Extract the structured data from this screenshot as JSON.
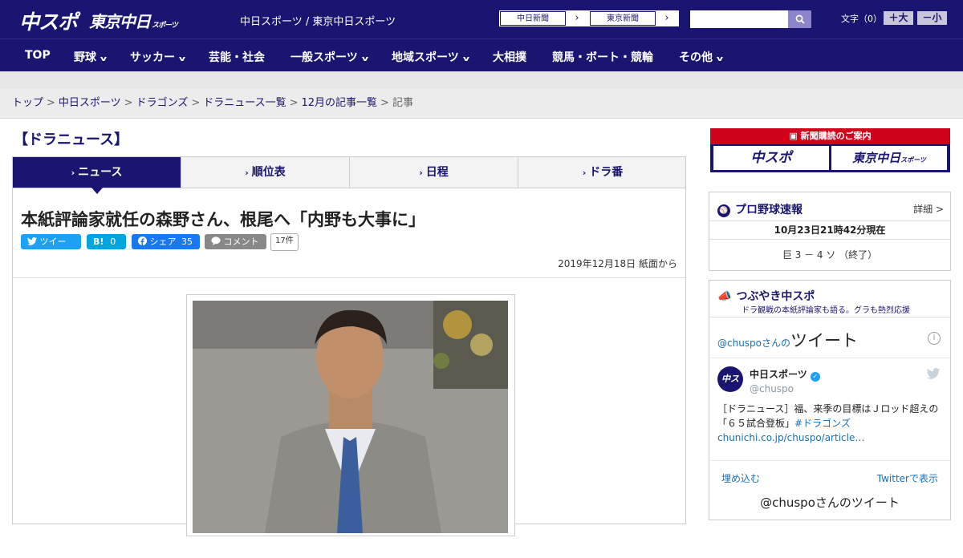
{
  "header": {
    "logo_main": "中スポ",
    "logo_tokyo": "東京中日",
    "logo_tokyo_sub": "スポーツ",
    "tagline": "中日スポーツ / 東京中日スポーツ",
    "paper_links": [
      {
        "label": "中日新聞"
      },
      {
        "label": "東京新聞"
      }
    ],
    "search": {
      "placeholder": "",
      "value": ""
    },
    "font_size_label": "文字（0）",
    "font_plus": "＋大",
    "font_minus": "－小"
  },
  "nav": {
    "items": [
      {
        "label": "TOP",
        "has_menu": false
      },
      {
        "label": "野球",
        "has_menu": true
      },
      {
        "label": "サッカー",
        "has_menu": true
      },
      {
        "label": "芸能・社会",
        "has_menu": false
      },
      {
        "label": "一般スポーツ",
        "has_menu": true
      },
      {
        "label": "地域スポーツ",
        "has_menu": true
      },
      {
        "label": "大相撲",
        "has_menu": false
      },
      {
        "label": "競馬・ボート・競輪",
        "has_menu": false
      },
      {
        "label": "その他",
        "has_menu": true
      }
    ]
  },
  "breadcrumb": {
    "items": [
      "トップ",
      "中日スポーツ",
      "ドラゴンズ",
      "ドラニュース一覧",
      "12月の記事一覧"
    ],
    "current": "記事",
    "separator": ">"
  },
  "section_title": "【ドラニュース】",
  "tabs": [
    {
      "label": "ニュース",
      "active": true
    },
    {
      "label": "順位表",
      "active": false
    },
    {
      "label": "日程",
      "active": false
    },
    {
      "label": "ドラ番",
      "active": false
    }
  ],
  "article": {
    "headline": "本紙評論家就任の森野さん、根尾へ「内野も大事に」",
    "social": {
      "tweet_label": "ツイート",
      "hatena_label": "B!",
      "hatena_count": "0",
      "share_label": "シェア",
      "share_count": "35",
      "comment_label": "コメント",
      "comment_count": "17件"
    },
    "date": "2019年12月18日 紙面から"
  },
  "sidebar": {
    "ad": {
      "top_label": "新聞購読のご案内",
      "left_logo": "中スポ",
      "right_logo": "東京中日",
      "right_logo_sub": "スポーツ"
    },
    "baseball": {
      "title": "プロ野球速報",
      "detail_link": "詳細 >",
      "updated": "10月23日21時42分現在",
      "score_line": "巨 3 － 4 ソ （終了）"
    },
    "tweets": {
      "title": "つぶやき中スポ",
      "subtitle": "ドラ観戦の本紙評論家も語る。グラも熱烈応援",
      "widget_prefix": "@chuspoさんの",
      "widget_title": "ツイート",
      "author_name": "中日スポーツ",
      "author_handle": "@chuspo",
      "avatar_text": "中スポ",
      "tweet_text": "［ドラニュース］福、来季の目標はＪロッド超えの「６５試合登板」",
      "tweet_hashtag": "#ドラゴンズ",
      "tweet_link": "chunichi.co.jp/chuspo/article…",
      "embed_label": "埋め込む",
      "view_label": "Twitterで表示",
      "more_label": "@chuspoさんのツイート"
    }
  },
  "colors": {
    "brand": "#1a1570",
    "twitter": "#1da1f2",
    "facebook": "#1877f2",
    "hatena": "#00a4de"
  }
}
